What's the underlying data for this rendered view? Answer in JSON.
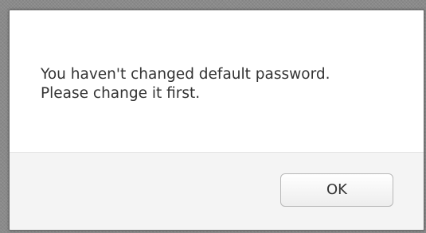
{
  "dialog": {
    "message_line_1": "You haven't changed default password.",
    "message_line_2": "Please change it first.",
    "ok_label": "OK"
  },
  "colors": {
    "overlay": "#8a8a8a",
    "dialog_background": "#ffffff",
    "footer_background": "#f4f4f4",
    "text": "#333333",
    "button_border": "#b8b8b8"
  }
}
